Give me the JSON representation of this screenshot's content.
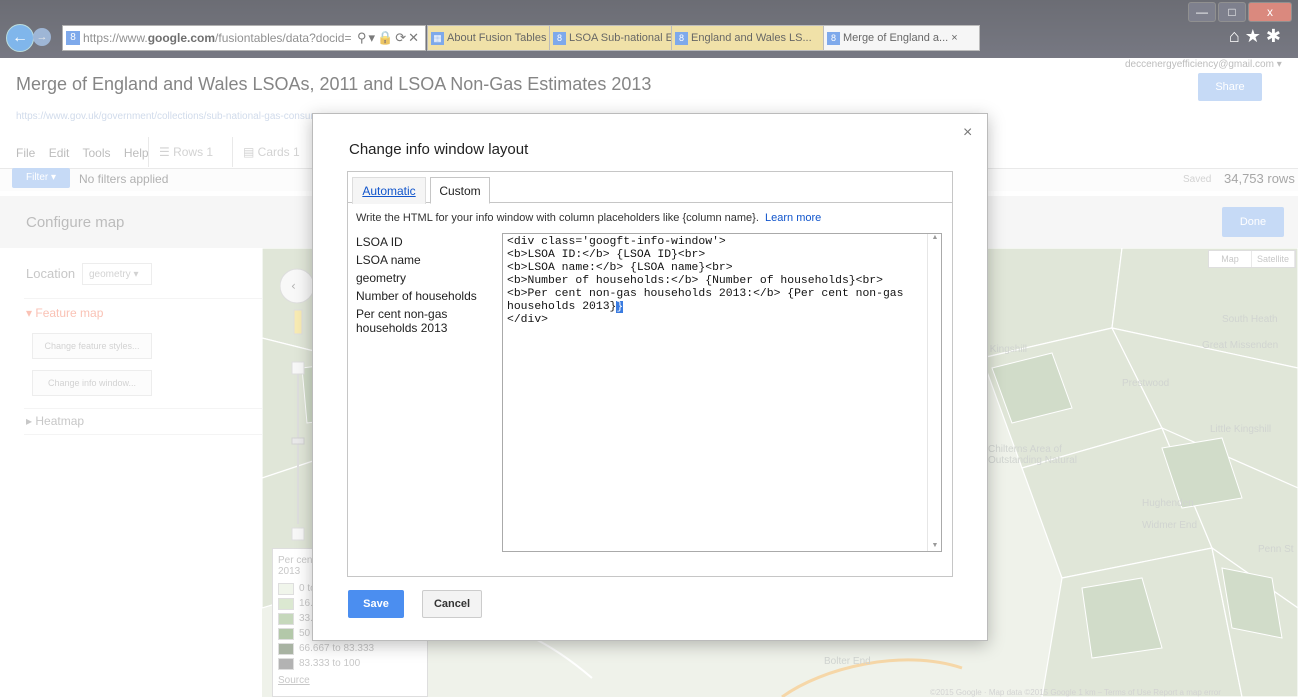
{
  "browser": {
    "url_prefix": "https://www.",
    "url_domain": "google.com",
    "url_rest": "/fusiontables/data?docid=",
    "tabs": [
      {
        "label": "About Fusion Tables - F...",
        "active": false
      },
      {
        "label": "LSOA Sub-national Esti...",
        "active": false
      },
      {
        "label": "England and Wales LS...",
        "active": false
      },
      {
        "label": "Merge of England a...",
        "active": true
      }
    ],
    "window_buttons": {
      "minimize": "—",
      "maximize": "□",
      "close": "x"
    },
    "right_icons": [
      "home-icon",
      "star-icon",
      "gear-icon"
    ]
  },
  "page": {
    "title": "Merge of England and Wales LSOAs, 2011 and LSOA Non-Gas Estimates 2013",
    "user_email": "deccenergyefficiency@gmail.com ▾",
    "share_label": "Share",
    "source_link": "https://www.gov.uk/government/collections/sub-national-gas-consumption",
    "menu": [
      "File",
      "Edit",
      "Tools",
      "Help"
    ],
    "view_tabs": [
      "Rows 1",
      "Cards 1"
    ],
    "filter_label": "Filter ▾",
    "filters_text": "No filters applied",
    "saved_text": "Saved",
    "rows_text": "34,753 rows",
    "config_title": "Configure map",
    "done_label": "Done"
  },
  "sidebar": {
    "location_label": "Location",
    "location_value": "geometry ▾",
    "feature_map": "▾ Feature map",
    "change_styles": "Change feature styles...",
    "change_info": "Change info window...",
    "heatmap": "▸ Heatmap"
  },
  "map": {
    "map_label": "Map",
    "satellite_label": "Satellite",
    "labels": [
      "South Heath",
      "Great Missenden",
      "Prestwood",
      "Chilterns Area of Outstanding Natural",
      "Little Kingshill",
      "Great Kingshill",
      "Hughenden",
      "Bolter End",
      "Widmer End",
      "Penn St"
    ],
    "attribution": "©2015 Google · Map data ©2015 Google   1 km ⎯   Terms of Use   Report a map error"
  },
  "legend": {
    "title": "Per cent non-gas households 2013",
    "rows": [
      {
        "label": "0 to 16.667",
        "color": "#e8f0e0"
      },
      {
        "label": "16.667 to 33.333",
        "color": "#c8dcb8"
      },
      {
        "label": "33.333 to 50",
        "color": "#a8c498"
      },
      {
        "label": "50 to 66.667",
        "color": "#8aab7c"
      },
      {
        "label": "66.667 to 83.333",
        "color": "#7a8a70"
      },
      {
        "label": "83.333 to 100",
        "color": "#8a8a8a"
      }
    ],
    "source": "Source"
  },
  "dialog": {
    "title": "Change info window layout",
    "close": "×",
    "tab_automatic": "Automatic",
    "tab_custom": "Custom",
    "instructions": "Write the HTML for your info window with column placeholders like {column name}.",
    "learn_more": "Learn more",
    "columns": [
      "LSOA ID",
      "LSOA name",
      "geometry",
      "Number of households",
      "Per cent non-gas households 2013"
    ],
    "html_text": "<div class='googft-info-window'>\n<b>LSOA ID:</b> {LSOA ID}<br>\n<b>LSOA name:</b> {LSOA name}<br>\n<b>Number of households:</b> {Number of households}<br>\n<b>Per cent non-gas households 2013:</b> {Per cent non-gas households 2013}",
    "html_text_end": "\n</div>",
    "save_label": "Save",
    "cancel_label": "Cancel"
  }
}
